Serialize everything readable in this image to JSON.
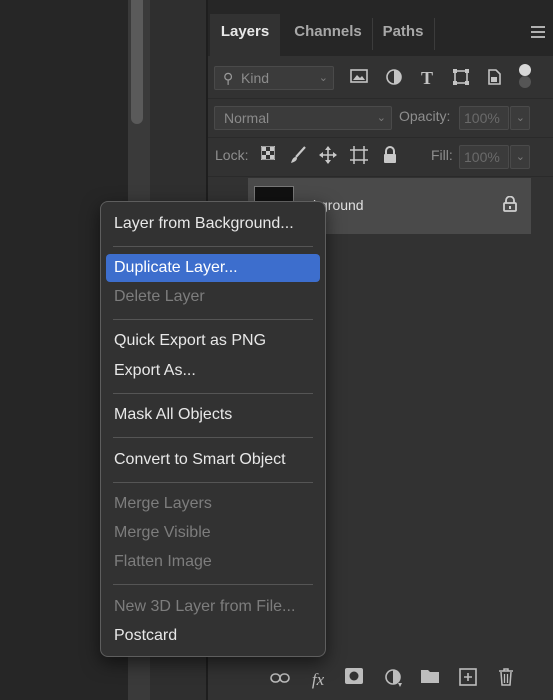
{
  "panel": {
    "tabs": [
      {
        "label": "Layers",
        "active": true
      },
      {
        "label": "Channels",
        "active": false
      },
      {
        "label": "Paths",
        "active": false
      }
    ],
    "filter": {
      "kind_label": "Kind",
      "icons": [
        "image-filter-icon",
        "adjustment-filter-icon",
        "type-filter-icon",
        "shape-filter-icon",
        "smart-object-filter-icon",
        "filter-toggle-icon"
      ]
    },
    "blend_mode": "Normal",
    "opacity_label": "Opacity:",
    "opacity_value": "100%",
    "lock_label": "Lock:",
    "fill_label": "Fill:",
    "fill_value": "100%",
    "layer": {
      "name": "Background",
      "visible_name": "ckground",
      "locked": true
    },
    "bottom_icons": [
      "link-icon",
      "fx-icon",
      "mask-icon",
      "adjustment-icon",
      "folder-icon",
      "new-layer-icon",
      "trash-icon"
    ]
  },
  "context_menu": {
    "items": [
      {
        "label": "Layer from Background...",
        "state": "enabled"
      },
      {
        "label": "Duplicate Layer...",
        "state": "highlighted"
      },
      {
        "label": "Delete Layer",
        "state": "disabled"
      },
      {
        "label": "Quick Export as PNG",
        "state": "enabled"
      },
      {
        "label": "Export As...",
        "state": "enabled"
      },
      {
        "label": "Mask All Objects",
        "state": "enabled"
      },
      {
        "label": "Convert to Smart Object",
        "state": "enabled"
      },
      {
        "label": "Merge Layers",
        "state": "disabled"
      },
      {
        "label": "Merge Visible",
        "state": "disabled"
      },
      {
        "label": "Flatten Image",
        "state": "disabled"
      },
      {
        "label": "New 3D Layer from File...",
        "state": "disabled"
      },
      {
        "label": "Postcard",
        "state": "enabled"
      }
    ]
  },
  "colors": {
    "highlight": "#3d6ecd",
    "panel_bg": "#323232",
    "tab_bg": "#262626"
  }
}
